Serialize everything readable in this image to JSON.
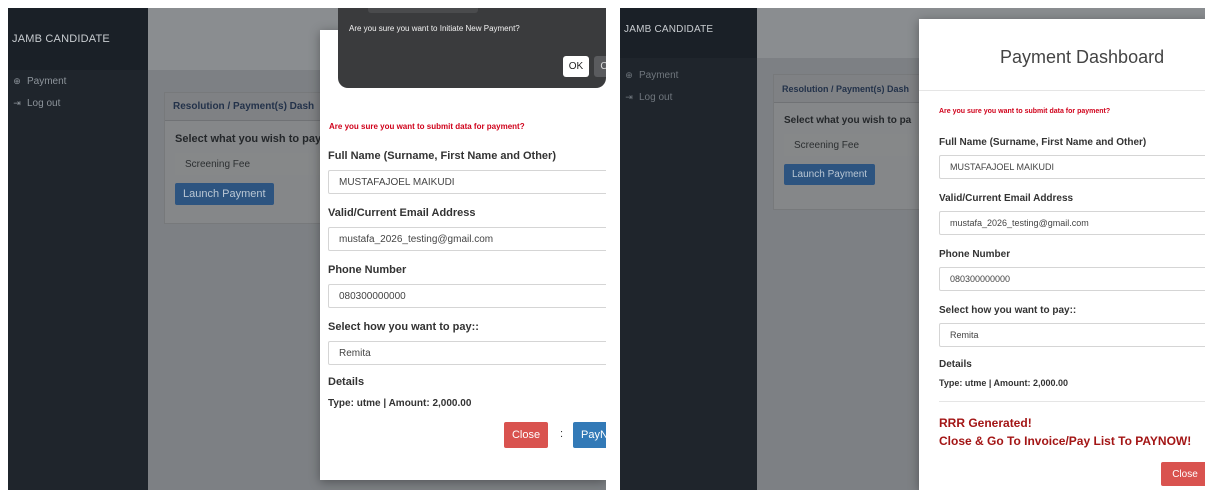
{
  "app": {
    "brand": "JAMB CANDIDATE"
  },
  "sidebar": {
    "items": [
      {
        "label": "Payment",
        "icon": "payment-icon"
      },
      {
        "label": "Log out",
        "icon": "logout-icon"
      }
    ]
  },
  "content": {
    "card_title": "Resolution / Payment(s) Dashboard",
    "card_title_visible": "Resolution / Payment(s) Dash",
    "select_question": "Select what you wish to pay",
    "select_question_visible_1": "Select what you wish to pay",
    "select_question_visible_2": "Select what you wish to pa",
    "selected_fee": "Screening Fee",
    "launch_button": "Launch Payment"
  },
  "confirm_dialog": {
    "message": "Are you sure you want to Initiate New Payment?",
    "ok_label": "OK",
    "cancel_label_visible": "C"
  },
  "form_modal": {
    "title": "Payment Dashboard",
    "warning": "Are you sure you want to submit data for payment?",
    "full_name_label": "Full Name (Surname, First Name and Other)",
    "full_name_value": "MUSTAFAJOEL MAIKUDI",
    "email_label": "Valid/Current Email Address",
    "email_value": "mustafa_2026_testing@gmail.com",
    "phone_label": "Phone Number",
    "phone_value": "080300000000",
    "pay_method_label": "Select how you want to pay::",
    "pay_method_value": "Remita",
    "details_label": "Details",
    "details_value": "Type: utme | Amount: 2,000.00",
    "close_label": "Close",
    "separator": ":",
    "paynow_visible": "PayN"
  },
  "result": {
    "line1": "RRR Generated!",
    "line2": "Close & Go To Invoice/Pay List To PAYNOW!"
  },
  "colors": {
    "sidebar_bg": "#1f252c",
    "warning_red": "#d0021b",
    "close_red": "#d9534f",
    "primary_blue": "#337ab7",
    "rrr_text": "#a31515"
  }
}
